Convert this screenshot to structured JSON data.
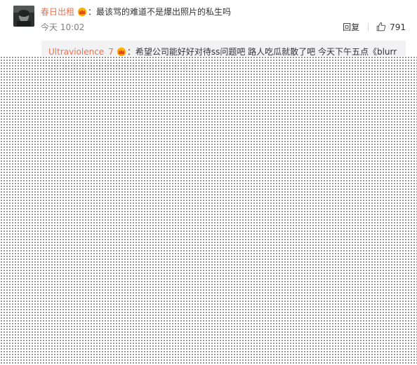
{
  "comment": {
    "username": "春日出租",
    "colon": "：",
    "text": "最该骂的难道不是爆出照片的私生吗",
    "time": "今天 10:02",
    "reply_label": "回复",
    "like_count": "791",
    "badge_icon": "vip-crown-icon",
    "like_icon": "thumbs-up-icon"
  },
  "reply": {
    "username": "Ultraviolence_7",
    "colon": "：",
    "text": "希望公司能好好对待ss问题吧 路人吃瓜就散了吧 今天下午五点《blurry》新曲发布请期待吧感谢各位的关注了",
    "badge_icon": "vip-crown-icon"
  },
  "colors": {
    "username": "#eb7350",
    "reply_bg": "#f2f2f5",
    "meta": "#808080"
  }
}
